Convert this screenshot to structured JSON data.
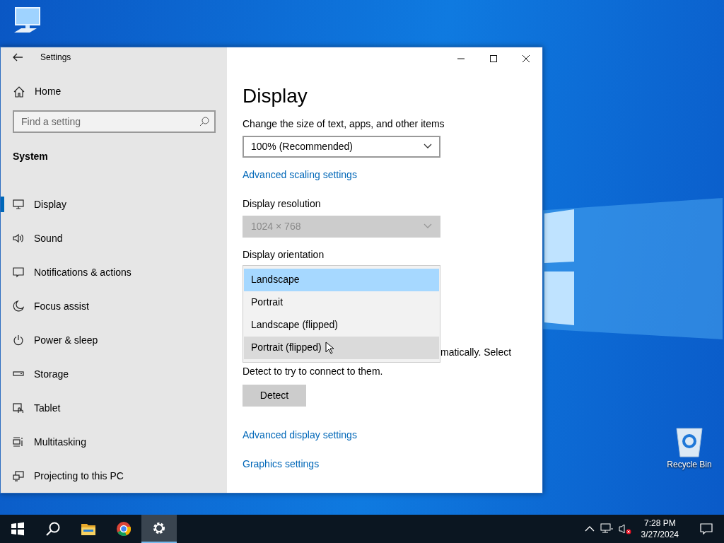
{
  "desktop_icons": [
    {
      "label": "Recycle Bin"
    }
  ],
  "window": {
    "title": "Settings"
  },
  "sidebar": {
    "home": "Home",
    "search": {
      "placeholder": "Find a setting"
    },
    "section": "System",
    "items": [
      {
        "label": "Display",
        "kind": "display",
        "selected": true
      },
      {
        "label": "Sound",
        "kind": "sound",
        "selected": false
      },
      {
        "label": "Notifications & actions",
        "kind": "notifications",
        "selected": false
      },
      {
        "label": "Focus assist",
        "kind": "moon",
        "selected": false
      },
      {
        "label": "Power & sleep",
        "kind": "power",
        "selected": false
      },
      {
        "label": "Storage",
        "kind": "storage",
        "selected": false
      },
      {
        "label": "Tablet",
        "kind": "tablet",
        "selected": false
      },
      {
        "label": "Multitasking",
        "kind": "multitasking",
        "selected": false
      },
      {
        "label": "Projecting to this PC",
        "kind": "projecting",
        "selected": false
      }
    ]
  },
  "content": {
    "title": "Display",
    "scale": {
      "label": "Change the size of text, apps, and other items",
      "value": "100% (Recommended)",
      "disabled": false
    },
    "scaling_link": "Advanced scaling settings",
    "resolution": {
      "label": "Display resolution",
      "value": "1024 × 768",
      "disabled": true
    },
    "orientation": {
      "label": "Display orientation",
      "options": [
        {
          "label": "Landscape",
          "selected": true,
          "hovered": false
        },
        {
          "label": "Portrait",
          "selected": false,
          "hovered": false
        },
        {
          "label": "Landscape (flipped)",
          "selected": false,
          "hovered": false
        },
        {
          "label": "Portrait (flipped)",
          "selected": false,
          "hovered": true
        }
      ]
    },
    "detect_text_fragment": "matically. Select",
    "detect_text": "Detect to try to connect to them.",
    "detect_button": "Detect",
    "links": [
      "Advanced display settings",
      "Graphics settings"
    ]
  },
  "taskbar": {
    "apps": [
      {
        "kind": "start",
        "active": false
      },
      {
        "kind": "search",
        "active": false
      },
      {
        "kind": "folder",
        "active": false
      },
      {
        "kind": "browser",
        "active": false
      },
      {
        "kind": "settings",
        "active": true
      }
    ],
    "time": "7:28 PM",
    "date": "3/27/2024"
  }
}
